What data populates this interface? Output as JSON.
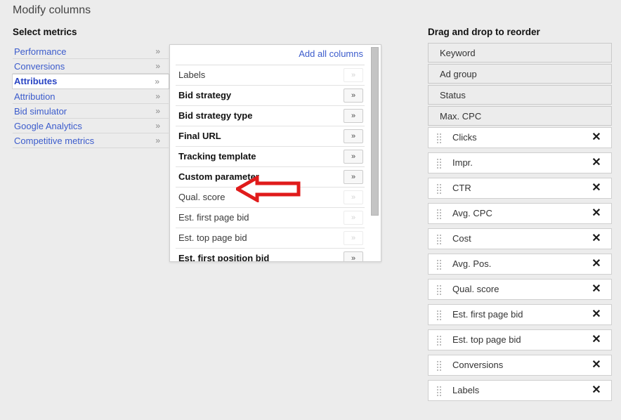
{
  "header": {
    "page_title": "Modify columns",
    "select_metrics_title": "Select metrics",
    "reorder_title": "Drag and drop to reorder"
  },
  "categories": [
    {
      "label": "Performance",
      "chevron": "»",
      "selected": false
    },
    {
      "label": "Conversions",
      "chevron": "»",
      "selected": false
    },
    {
      "label": "Attributes",
      "chevron": "»",
      "selected": true
    },
    {
      "label": "Attribution",
      "chevron": "»",
      "selected": false
    },
    {
      "label": "Bid simulator",
      "chevron": "»",
      "selected": false
    },
    {
      "label": "Google Analytics",
      "chevron": "»",
      "selected": false
    },
    {
      "label": "Competitive metrics",
      "chevron": "»",
      "selected": false
    }
  ],
  "metric_panel": {
    "add_all_label": "Add all columns",
    "add_button_glyph": "»",
    "rows": [
      {
        "label": "Labels",
        "state": "added"
      },
      {
        "label": "Bid strategy",
        "state": "addable"
      },
      {
        "label": "Bid strategy type",
        "state": "addable"
      },
      {
        "label": "Final URL",
        "state": "addable"
      },
      {
        "label": "Tracking template",
        "state": "addable"
      },
      {
        "label": "Custom parameter",
        "state": "addable"
      },
      {
        "label": "Qual. score",
        "state": "added"
      },
      {
        "label": "Est. first page bid",
        "state": "added"
      },
      {
        "label": "Est. top page bid",
        "state": "added"
      },
      {
        "label": "Est. first position bid",
        "state": "addable"
      }
    ]
  },
  "reorder_list": {
    "remove_glyph": "✕",
    "items": [
      {
        "label": "Keyword",
        "locked": true
      },
      {
        "label": "Ad group",
        "locked": true
      },
      {
        "label": "Status",
        "locked": true
      },
      {
        "label": "Max. CPC",
        "locked": true
      },
      {
        "label": "Clicks",
        "locked": false
      },
      {
        "label": "Impr.",
        "locked": false
      },
      {
        "label": "CTR",
        "locked": false
      },
      {
        "label": "Avg. CPC",
        "locked": false
      },
      {
        "label": "Cost",
        "locked": false
      },
      {
        "label": "Avg. Pos.",
        "locked": false
      },
      {
        "label": "Qual. score",
        "locked": false
      },
      {
        "label": "Est. first page bid",
        "locked": false
      },
      {
        "label": "Est. top page bid",
        "locked": false
      },
      {
        "label": "Conversions",
        "locked": false
      },
      {
        "label": "Labels",
        "locked": false
      }
    ]
  },
  "annotation": {
    "type": "left-arrow",
    "color": "#e01b1b",
    "points_at": "Qual. score"
  },
  "colors": {
    "page_background": "#ececec",
    "link_blue": "#3c5ccc",
    "panel_white": "#ffffff",
    "annotation_red": "#e01b1b"
  }
}
